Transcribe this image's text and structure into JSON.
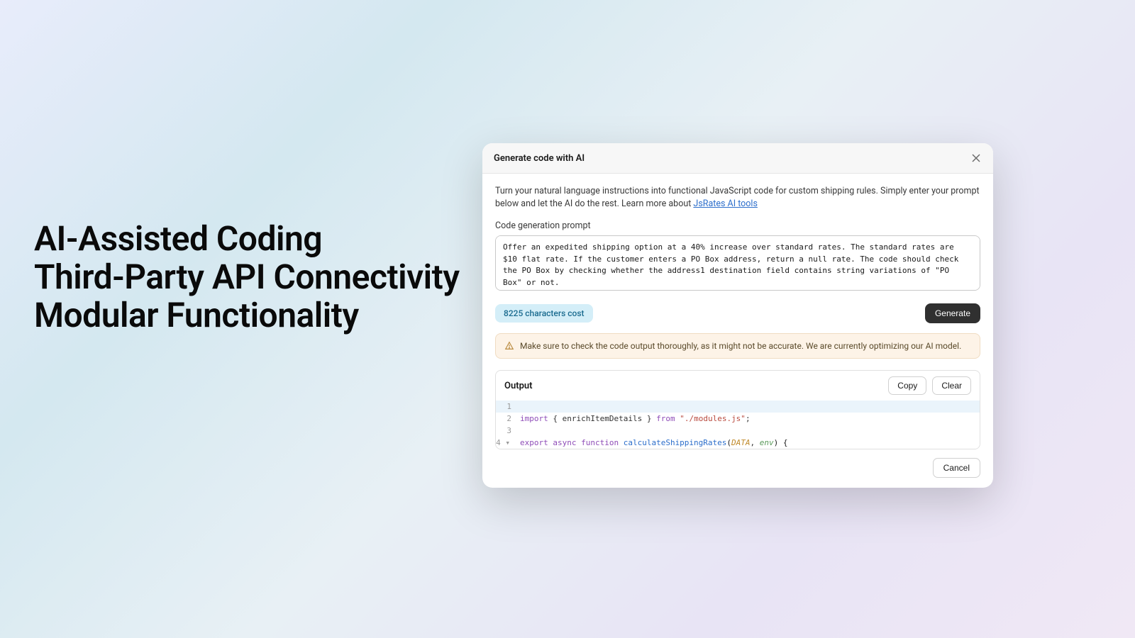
{
  "headlines": {
    "line1": "AI-Assisted Coding",
    "line2": "Third-Party API Connectivity",
    "line3": "Modular Functionality"
  },
  "modal": {
    "title": "Generate code with AI",
    "description_prefix": "Turn your natural language instructions into functional JavaScript code for custom shipping rules. Simply enter your prompt below and let the AI do the rest. Learn more about ",
    "description_link": "JsRates AI tools",
    "prompt_label": "Code generation prompt",
    "prompt_value": "Offer an expedited shipping option at a 40% increase over standard rates. The standard rates are $10 flat rate. If the customer enters a PO Box address, return a null rate. The code should check the PO Box by checking whether the address1 destination field contains string variations of \"PO Box\" or not.",
    "cost_badge": "8225 characters cost",
    "generate_button": "Generate",
    "warning_text": "Make sure to check the code output thoroughly, as it might not be accurate. We are currently optimizing our AI model.",
    "output_label": "Output",
    "copy_button": "Copy",
    "clear_button": "Clear",
    "cancel_button": "Cancel",
    "code": {
      "line1_num": "1",
      "line2_num": "2",
      "line2_import": "import",
      "line2_braces_open": " { ",
      "line2_ident": "enrichItemDetails",
      "line2_braces_close": " } ",
      "line2_from": "from",
      "line2_string": " \"./modules.js\"",
      "line2_semi": ";",
      "line3_num": "3",
      "line4_num": "4",
      "line4_export": "export",
      "line4_async": " async ",
      "line4_function": "function",
      "line4_name": " calculateShippingRates",
      "line4_paren_open": "(",
      "line4_param1": "DATA",
      "line4_comma": ", ",
      "line4_param2": "env",
      "line4_paren_close": ")",
      "line4_brace": " {"
    }
  }
}
